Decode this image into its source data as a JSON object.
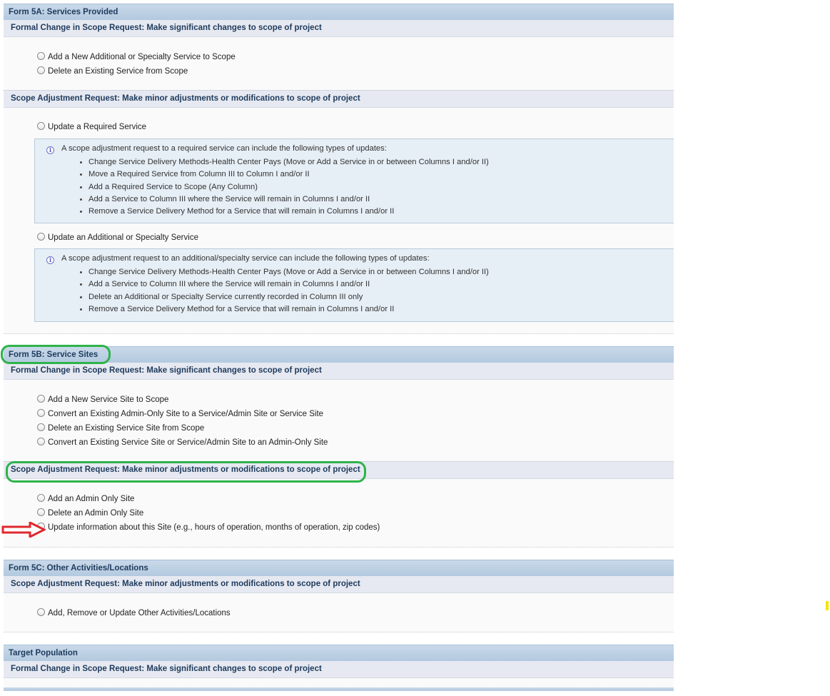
{
  "form_5a": {
    "title": "Form 5A: Services Provided",
    "formal_change": {
      "heading": "Formal Change in Scope Request: Make significant changes to scope of project",
      "options": [
        "Add a New Additional or Specialty Service to Scope",
        "Delete an Existing Service from Scope"
      ]
    },
    "scope_adjustment": {
      "heading": "Scope Adjustment Request: Make minor adjustments or modifications to scope of project",
      "required_option": "Update a Required Service",
      "required_info": {
        "intro": "A scope adjustment request to a required service can include the following types of updates:",
        "items": [
          "Change Service Delivery Methods-Health Center Pays (Move or Add a Service in or between Columns I and/or II)",
          "Move a Required Service from Column III to Column I and/or II",
          "Add a Required Service to Scope (Any Column)",
          "Add a Service to Column III where the Service will remain in Columns I and/or II",
          "Remove a Service Delivery Method for a Service that will remain in Columns I and/or II"
        ]
      },
      "additional_option": "Update an Additional or Specialty Service",
      "additional_info": {
        "intro": "A scope adjustment request to an additional/specialty service can include the following types of updates:",
        "items": [
          "Change Service Delivery Methods-Health Center Pays (Move or Add a Service in or between Columns I and/or II)",
          "Add a Service to Column III where the Service will remain in Columns I and/or II",
          "Delete an Additional or Specialty Service currently recorded in Column III only",
          "Remove a Service Delivery Method for a Service that will remain in Columns I and/or II"
        ]
      }
    }
  },
  "form_5b": {
    "title": "Form 5B: Service Sites",
    "formal_change": {
      "heading": "Formal Change in Scope Request: Make significant changes to scope of project",
      "options": [
        "Add a New Service Site to Scope",
        "Convert an Existing Admin-Only Site to a Service/Admin Site or Service Site",
        "Delete an Existing Service Site from Scope",
        "Convert an Existing Service Site or Service/Admin Site to an Admin-Only Site"
      ]
    },
    "scope_adjustment": {
      "heading": "Scope Adjustment Request: Make minor adjustments or modifications to scope of project",
      "options": [
        "Add an Admin Only Site",
        "Delete an Admin Only Site",
        "Update information about this Site (e.g., hours of operation, months of operation, zip codes)"
      ]
    }
  },
  "form_5c": {
    "title": "Form 5C: Other Activities/Locations",
    "scope_adjustment": {
      "heading": "Scope Adjustment Request: Make minor adjustments or modifications to scope of project",
      "options": [
        "Add, Remove or Update Other Activities/Locations"
      ]
    }
  },
  "target_population": {
    "title": "Target Population",
    "formal_change": {
      "heading": "Formal Change in Scope Request: Make significant changes to scope of project"
    }
  },
  "annotation_colors": {
    "highlight": "#2eb34a",
    "arrow": "#e0282e",
    "mark": "#f2e600"
  }
}
